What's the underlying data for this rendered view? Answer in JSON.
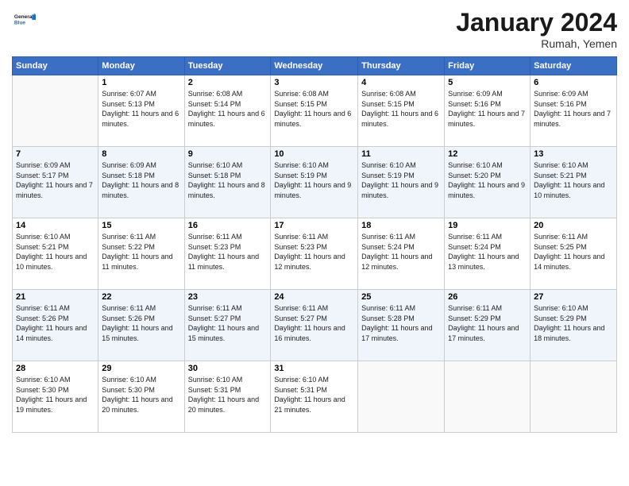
{
  "header": {
    "logo_line1": "General",
    "logo_line2": "Blue",
    "month": "January 2024",
    "location": "Rumah, Yemen"
  },
  "weekdays": [
    "Sunday",
    "Monday",
    "Tuesday",
    "Wednesday",
    "Thursday",
    "Friday",
    "Saturday"
  ],
  "weeks": [
    [
      {
        "day": "",
        "sunrise": "",
        "sunset": "",
        "daylight": ""
      },
      {
        "day": "1",
        "sunrise": "Sunrise: 6:07 AM",
        "sunset": "Sunset: 5:13 PM",
        "daylight": "Daylight: 11 hours and 6 minutes."
      },
      {
        "day": "2",
        "sunrise": "Sunrise: 6:08 AM",
        "sunset": "Sunset: 5:14 PM",
        "daylight": "Daylight: 11 hours and 6 minutes."
      },
      {
        "day": "3",
        "sunrise": "Sunrise: 6:08 AM",
        "sunset": "Sunset: 5:15 PM",
        "daylight": "Daylight: 11 hours and 6 minutes."
      },
      {
        "day": "4",
        "sunrise": "Sunrise: 6:08 AM",
        "sunset": "Sunset: 5:15 PM",
        "daylight": "Daylight: 11 hours and 6 minutes."
      },
      {
        "day": "5",
        "sunrise": "Sunrise: 6:09 AM",
        "sunset": "Sunset: 5:16 PM",
        "daylight": "Daylight: 11 hours and 7 minutes."
      },
      {
        "day": "6",
        "sunrise": "Sunrise: 6:09 AM",
        "sunset": "Sunset: 5:16 PM",
        "daylight": "Daylight: 11 hours and 7 minutes."
      }
    ],
    [
      {
        "day": "7",
        "sunrise": "Sunrise: 6:09 AM",
        "sunset": "Sunset: 5:17 PM",
        "daylight": "Daylight: 11 hours and 7 minutes."
      },
      {
        "day": "8",
        "sunrise": "Sunrise: 6:09 AM",
        "sunset": "Sunset: 5:18 PM",
        "daylight": "Daylight: 11 hours and 8 minutes."
      },
      {
        "day": "9",
        "sunrise": "Sunrise: 6:10 AM",
        "sunset": "Sunset: 5:18 PM",
        "daylight": "Daylight: 11 hours and 8 minutes."
      },
      {
        "day": "10",
        "sunrise": "Sunrise: 6:10 AM",
        "sunset": "Sunset: 5:19 PM",
        "daylight": "Daylight: 11 hours and 9 minutes."
      },
      {
        "day": "11",
        "sunrise": "Sunrise: 6:10 AM",
        "sunset": "Sunset: 5:19 PM",
        "daylight": "Daylight: 11 hours and 9 minutes."
      },
      {
        "day": "12",
        "sunrise": "Sunrise: 6:10 AM",
        "sunset": "Sunset: 5:20 PM",
        "daylight": "Daylight: 11 hours and 9 minutes."
      },
      {
        "day": "13",
        "sunrise": "Sunrise: 6:10 AM",
        "sunset": "Sunset: 5:21 PM",
        "daylight": "Daylight: 11 hours and 10 minutes."
      }
    ],
    [
      {
        "day": "14",
        "sunrise": "Sunrise: 6:10 AM",
        "sunset": "Sunset: 5:21 PM",
        "daylight": "Daylight: 11 hours and 10 minutes."
      },
      {
        "day": "15",
        "sunrise": "Sunrise: 6:11 AM",
        "sunset": "Sunset: 5:22 PM",
        "daylight": "Daylight: 11 hours and 11 minutes."
      },
      {
        "day": "16",
        "sunrise": "Sunrise: 6:11 AM",
        "sunset": "Sunset: 5:23 PM",
        "daylight": "Daylight: 11 hours and 11 minutes."
      },
      {
        "day": "17",
        "sunrise": "Sunrise: 6:11 AM",
        "sunset": "Sunset: 5:23 PM",
        "daylight": "Daylight: 11 hours and 12 minutes."
      },
      {
        "day": "18",
        "sunrise": "Sunrise: 6:11 AM",
        "sunset": "Sunset: 5:24 PM",
        "daylight": "Daylight: 11 hours and 12 minutes."
      },
      {
        "day": "19",
        "sunrise": "Sunrise: 6:11 AM",
        "sunset": "Sunset: 5:24 PM",
        "daylight": "Daylight: 11 hours and 13 minutes."
      },
      {
        "day": "20",
        "sunrise": "Sunrise: 6:11 AM",
        "sunset": "Sunset: 5:25 PM",
        "daylight": "Daylight: 11 hours and 14 minutes."
      }
    ],
    [
      {
        "day": "21",
        "sunrise": "Sunrise: 6:11 AM",
        "sunset": "Sunset: 5:26 PM",
        "daylight": "Daylight: 11 hours and 14 minutes."
      },
      {
        "day": "22",
        "sunrise": "Sunrise: 6:11 AM",
        "sunset": "Sunset: 5:26 PM",
        "daylight": "Daylight: 11 hours and 15 minutes."
      },
      {
        "day": "23",
        "sunrise": "Sunrise: 6:11 AM",
        "sunset": "Sunset: 5:27 PM",
        "daylight": "Daylight: 11 hours and 15 minutes."
      },
      {
        "day": "24",
        "sunrise": "Sunrise: 6:11 AM",
        "sunset": "Sunset: 5:27 PM",
        "daylight": "Daylight: 11 hours and 16 minutes."
      },
      {
        "day": "25",
        "sunrise": "Sunrise: 6:11 AM",
        "sunset": "Sunset: 5:28 PM",
        "daylight": "Daylight: 11 hours and 17 minutes."
      },
      {
        "day": "26",
        "sunrise": "Sunrise: 6:11 AM",
        "sunset": "Sunset: 5:29 PM",
        "daylight": "Daylight: 11 hours and 17 minutes."
      },
      {
        "day": "27",
        "sunrise": "Sunrise: 6:10 AM",
        "sunset": "Sunset: 5:29 PM",
        "daylight": "Daylight: 11 hours and 18 minutes."
      }
    ],
    [
      {
        "day": "28",
        "sunrise": "Sunrise: 6:10 AM",
        "sunset": "Sunset: 5:30 PM",
        "daylight": "Daylight: 11 hours and 19 minutes."
      },
      {
        "day": "29",
        "sunrise": "Sunrise: 6:10 AM",
        "sunset": "Sunset: 5:30 PM",
        "daylight": "Daylight: 11 hours and 20 minutes."
      },
      {
        "day": "30",
        "sunrise": "Sunrise: 6:10 AM",
        "sunset": "Sunset: 5:31 PM",
        "daylight": "Daylight: 11 hours and 20 minutes."
      },
      {
        "day": "31",
        "sunrise": "Sunrise: 6:10 AM",
        "sunset": "Sunset: 5:31 PM",
        "daylight": "Daylight: 11 hours and 21 minutes."
      },
      {
        "day": "",
        "sunrise": "",
        "sunset": "",
        "daylight": ""
      },
      {
        "day": "",
        "sunrise": "",
        "sunset": "",
        "daylight": ""
      },
      {
        "day": "",
        "sunrise": "",
        "sunset": "",
        "daylight": ""
      }
    ]
  ]
}
